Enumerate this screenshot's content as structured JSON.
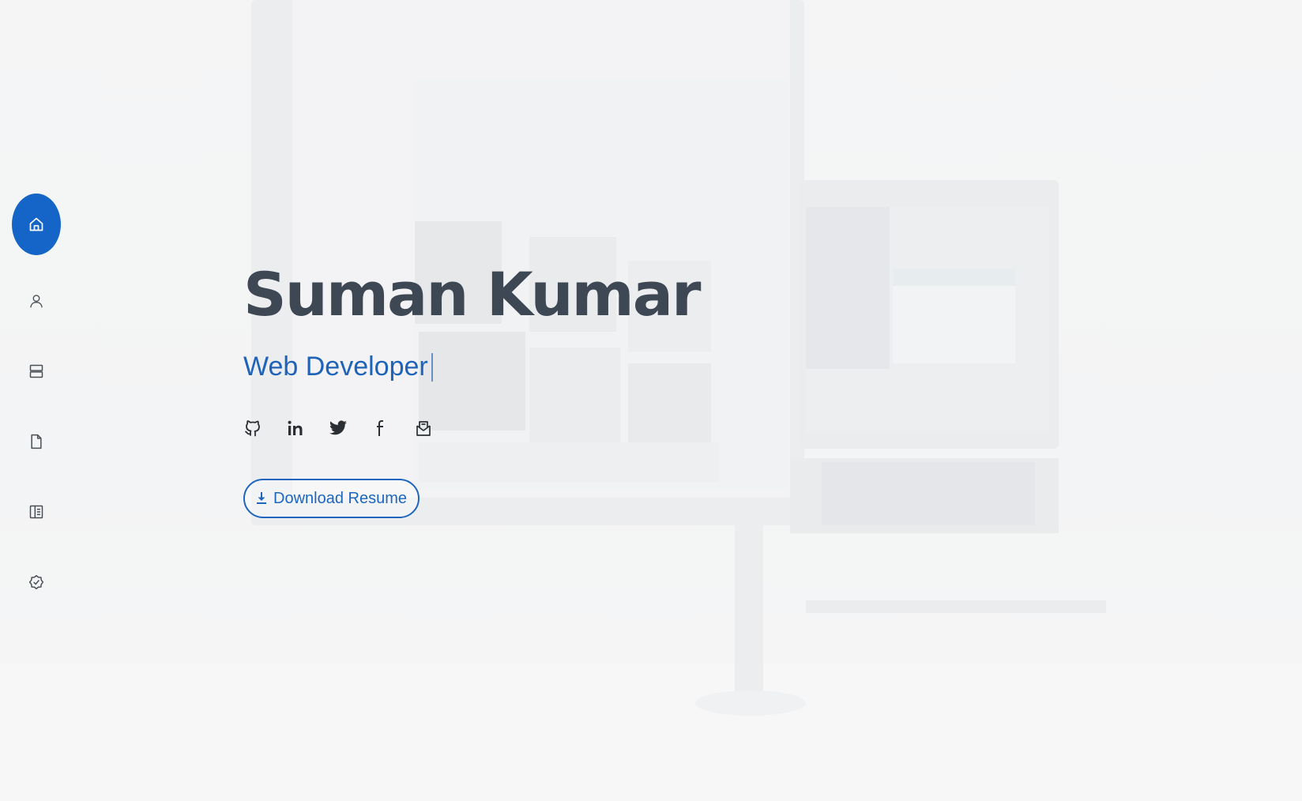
{
  "nav": {
    "items": [
      {
        "id": "home",
        "label": "Home",
        "icon": "home-icon",
        "active": true
      },
      {
        "id": "about",
        "label": "About",
        "icon": "user-icon",
        "active": false
      },
      {
        "id": "resume",
        "label": "Resume",
        "icon": "server-icon",
        "active": false
      },
      {
        "id": "projects",
        "label": "Projects",
        "icon": "file-icon",
        "active": false
      },
      {
        "id": "blog",
        "label": "Blog",
        "icon": "book-icon",
        "active": false
      },
      {
        "id": "certifications",
        "label": "Certifications",
        "icon": "badge-check-icon",
        "active": false
      }
    ]
  },
  "hero": {
    "name": "Suman Kumar",
    "role": "Web Developer",
    "social": [
      {
        "id": "github",
        "icon": "github-icon"
      },
      {
        "id": "linkedin",
        "icon": "linkedin-icon"
      },
      {
        "id": "twitter",
        "icon": "twitter-icon"
      },
      {
        "id": "facebook",
        "icon": "facebook-icon"
      },
      {
        "id": "email",
        "icon": "mail-icon"
      }
    ],
    "resume_button": {
      "label": "Download Resume",
      "icon": "download-icon"
    }
  },
  "colors": {
    "accent": "#1565c8",
    "name_text": "#3e4754",
    "role_text": "#1e63b8",
    "background": "#f3f4f5"
  }
}
